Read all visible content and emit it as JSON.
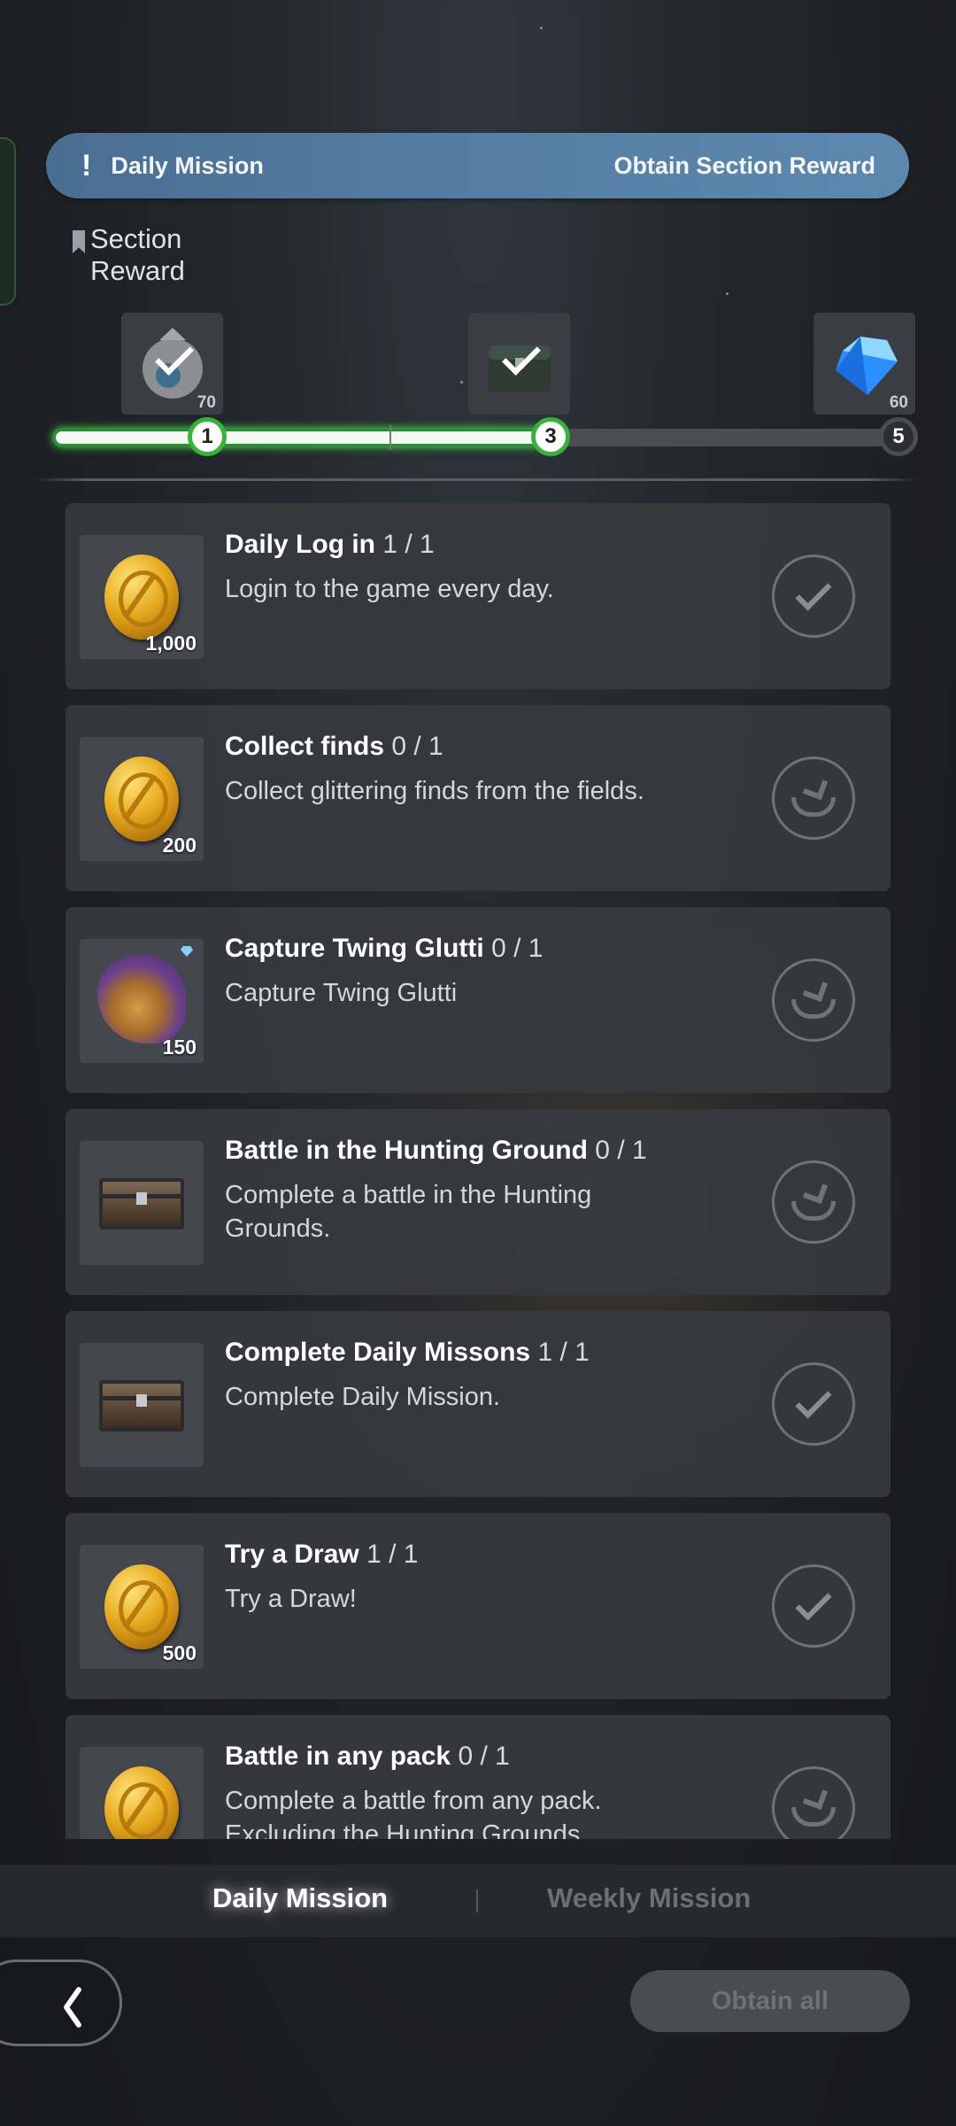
{
  "banner": {
    "icon": "exclamation-icon",
    "title": "Daily Mission",
    "action": "Obtain Section Reward"
  },
  "section_reward": {
    "label_line1": "Section",
    "label_line2": "Reward",
    "rewards": [
      {
        "name": "orb-reward",
        "quantity": "70",
        "claimed": true
      },
      {
        "name": "chest-reward",
        "quantity": "",
        "claimed": true
      },
      {
        "name": "gem-reward",
        "quantity": "60",
        "claimed": false
      }
    ],
    "milestones": [
      "1",
      "3",
      "5"
    ],
    "progress_fraction": 0.58
  },
  "missions": [
    {
      "title": "Daily Log in",
      "count": "1 / 1",
      "description": "Login to the game every day.",
      "reward_qty": "1,000",
      "reward_icon": "gold-coin",
      "status": "completed"
    },
    {
      "title": "Collect finds",
      "count": "0 / 1",
      "description": "Collect glittering finds from the fields.",
      "reward_qty": "200",
      "reward_icon": "gold-coin",
      "status": "claimable"
    },
    {
      "title": "Capture Twing Glutti",
      "count": "0 / 1",
      "description": "Capture Twing Glutti",
      "reward_qty": "150",
      "reward_icon": "creature",
      "status": "claimable"
    },
    {
      "title": "Battle in the Hunting Ground",
      "count": "0 / 1",
      "description": "Complete a battle in the Hunting Grounds.",
      "reward_qty": "",
      "reward_icon": "chest",
      "status": "claimable"
    },
    {
      "title": "Complete Daily Missons",
      "count": "1 / 1",
      "description": "Complete Daily Mission.",
      "reward_qty": "",
      "reward_icon": "chest",
      "status": "completed"
    },
    {
      "title": "Try a Draw",
      "count": "1 / 1",
      "description": "Try a Draw!",
      "reward_qty": "500",
      "reward_icon": "gold-coin",
      "status": "completed"
    },
    {
      "title": "Battle in any pack",
      "count": "0 / 1",
      "description": "Complete a battle from any pack. Excluding the Hunting Grounds.",
      "reward_qty": "",
      "reward_icon": "gold-coin",
      "status": "claimable"
    }
  ],
  "tabs": {
    "daily": "Daily Mission",
    "weekly": "Weekly Mission",
    "active": "daily"
  },
  "footer": {
    "obtain_all": "Obtain all"
  },
  "colors": {
    "banner": "#557da3",
    "progress_glow": "#38b23d",
    "card": "#37393e"
  }
}
